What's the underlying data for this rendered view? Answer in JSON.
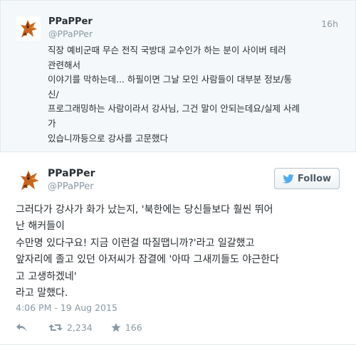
{
  "reply_tweet": {
    "display_name": "PPaPPer",
    "handle": "@PPaPPer",
    "time": "16h",
    "lines": [
      "직장 예비군때 무슨 전직 국방대 교수인가 하는 분이 사이버 테러",
      "관련해서",
      "이야기를 막하는데... 하필이면 그날 모인 사람들이 대부분 정보/통",
      "신/",
      "프로그래밍하는 사람이라서 강사님, 그건 말이 안되는데요/실제 사례",
      "가",
      "있습니까등으로 강사를 고문했다"
    ]
  },
  "main_tweet": {
    "display_name": "PPaPPer",
    "handle": "@PPaPPer",
    "follow_label": "Follow",
    "lines": [
      "그러다가 강사가 화가 났는지, '북한에는 당신들보다 훨씬 뛰어",
      "난 해커들이",
      "수만명 있다구요! 지금 이런걸 따질땝니까?'라고 일갈했고",
      "앞자리에 졸고 있던 아저씨가 잠결에 '아따 그새끼들도 야근한다",
      "고 고생하겠네'",
      "라고 말했다."
    ],
    "timestamp": "4:06 PM - 19 Aug 2015",
    "retweets": "2,234",
    "favorites": "166"
  },
  "icons": {
    "avatar": "dragon-avatar-icon",
    "follow": "twitter-bird-icon",
    "reply": "reply-arrow-icon",
    "retweet": "retweet-icon",
    "favorite": "star-icon"
  },
  "colors": {
    "reply_bg": "#f5f8fa",
    "meta_gray": "#8899a6",
    "text": "#292f33",
    "twitter_blue": "#55acee"
  }
}
